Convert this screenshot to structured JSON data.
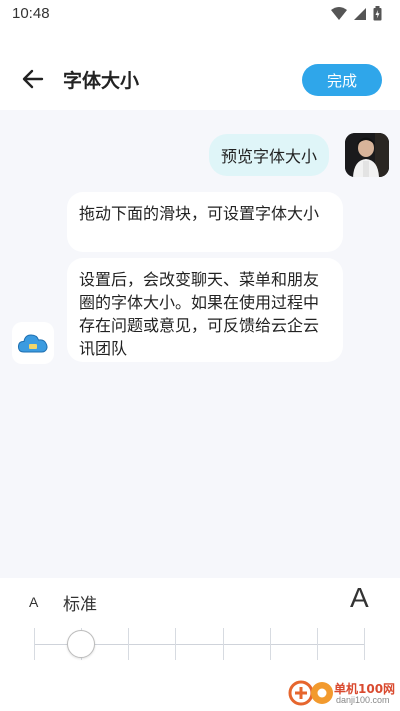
{
  "status_bar": {
    "time": "10:48",
    "icons": [
      "wifi-icon",
      "cellular-icon",
      "battery-icon"
    ]
  },
  "header": {
    "title": "字体大小",
    "done_label": "完成",
    "accent_color": "#2fa6ea"
  },
  "chat": {
    "right_bubble": "预览字体大小",
    "left_bubbles": [
      "拖动下面的滑块，可设置字体大小",
      "设置后，会改变聊天、菜单和朋友圈的字体大小。如果在使用过程中存在问题或意见，可反馈给云企云讯团队"
    ],
    "bubble_right_color": "#dff5f8"
  },
  "font_panel": {
    "small_label": "A",
    "current_size_label": "标准",
    "large_label": "A",
    "slider": {
      "steps": 8,
      "selected_index": 1
    }
  },
  "watermark": {
    "line1": "单机100网",
    "line2": "danji100.com"
  }
}
